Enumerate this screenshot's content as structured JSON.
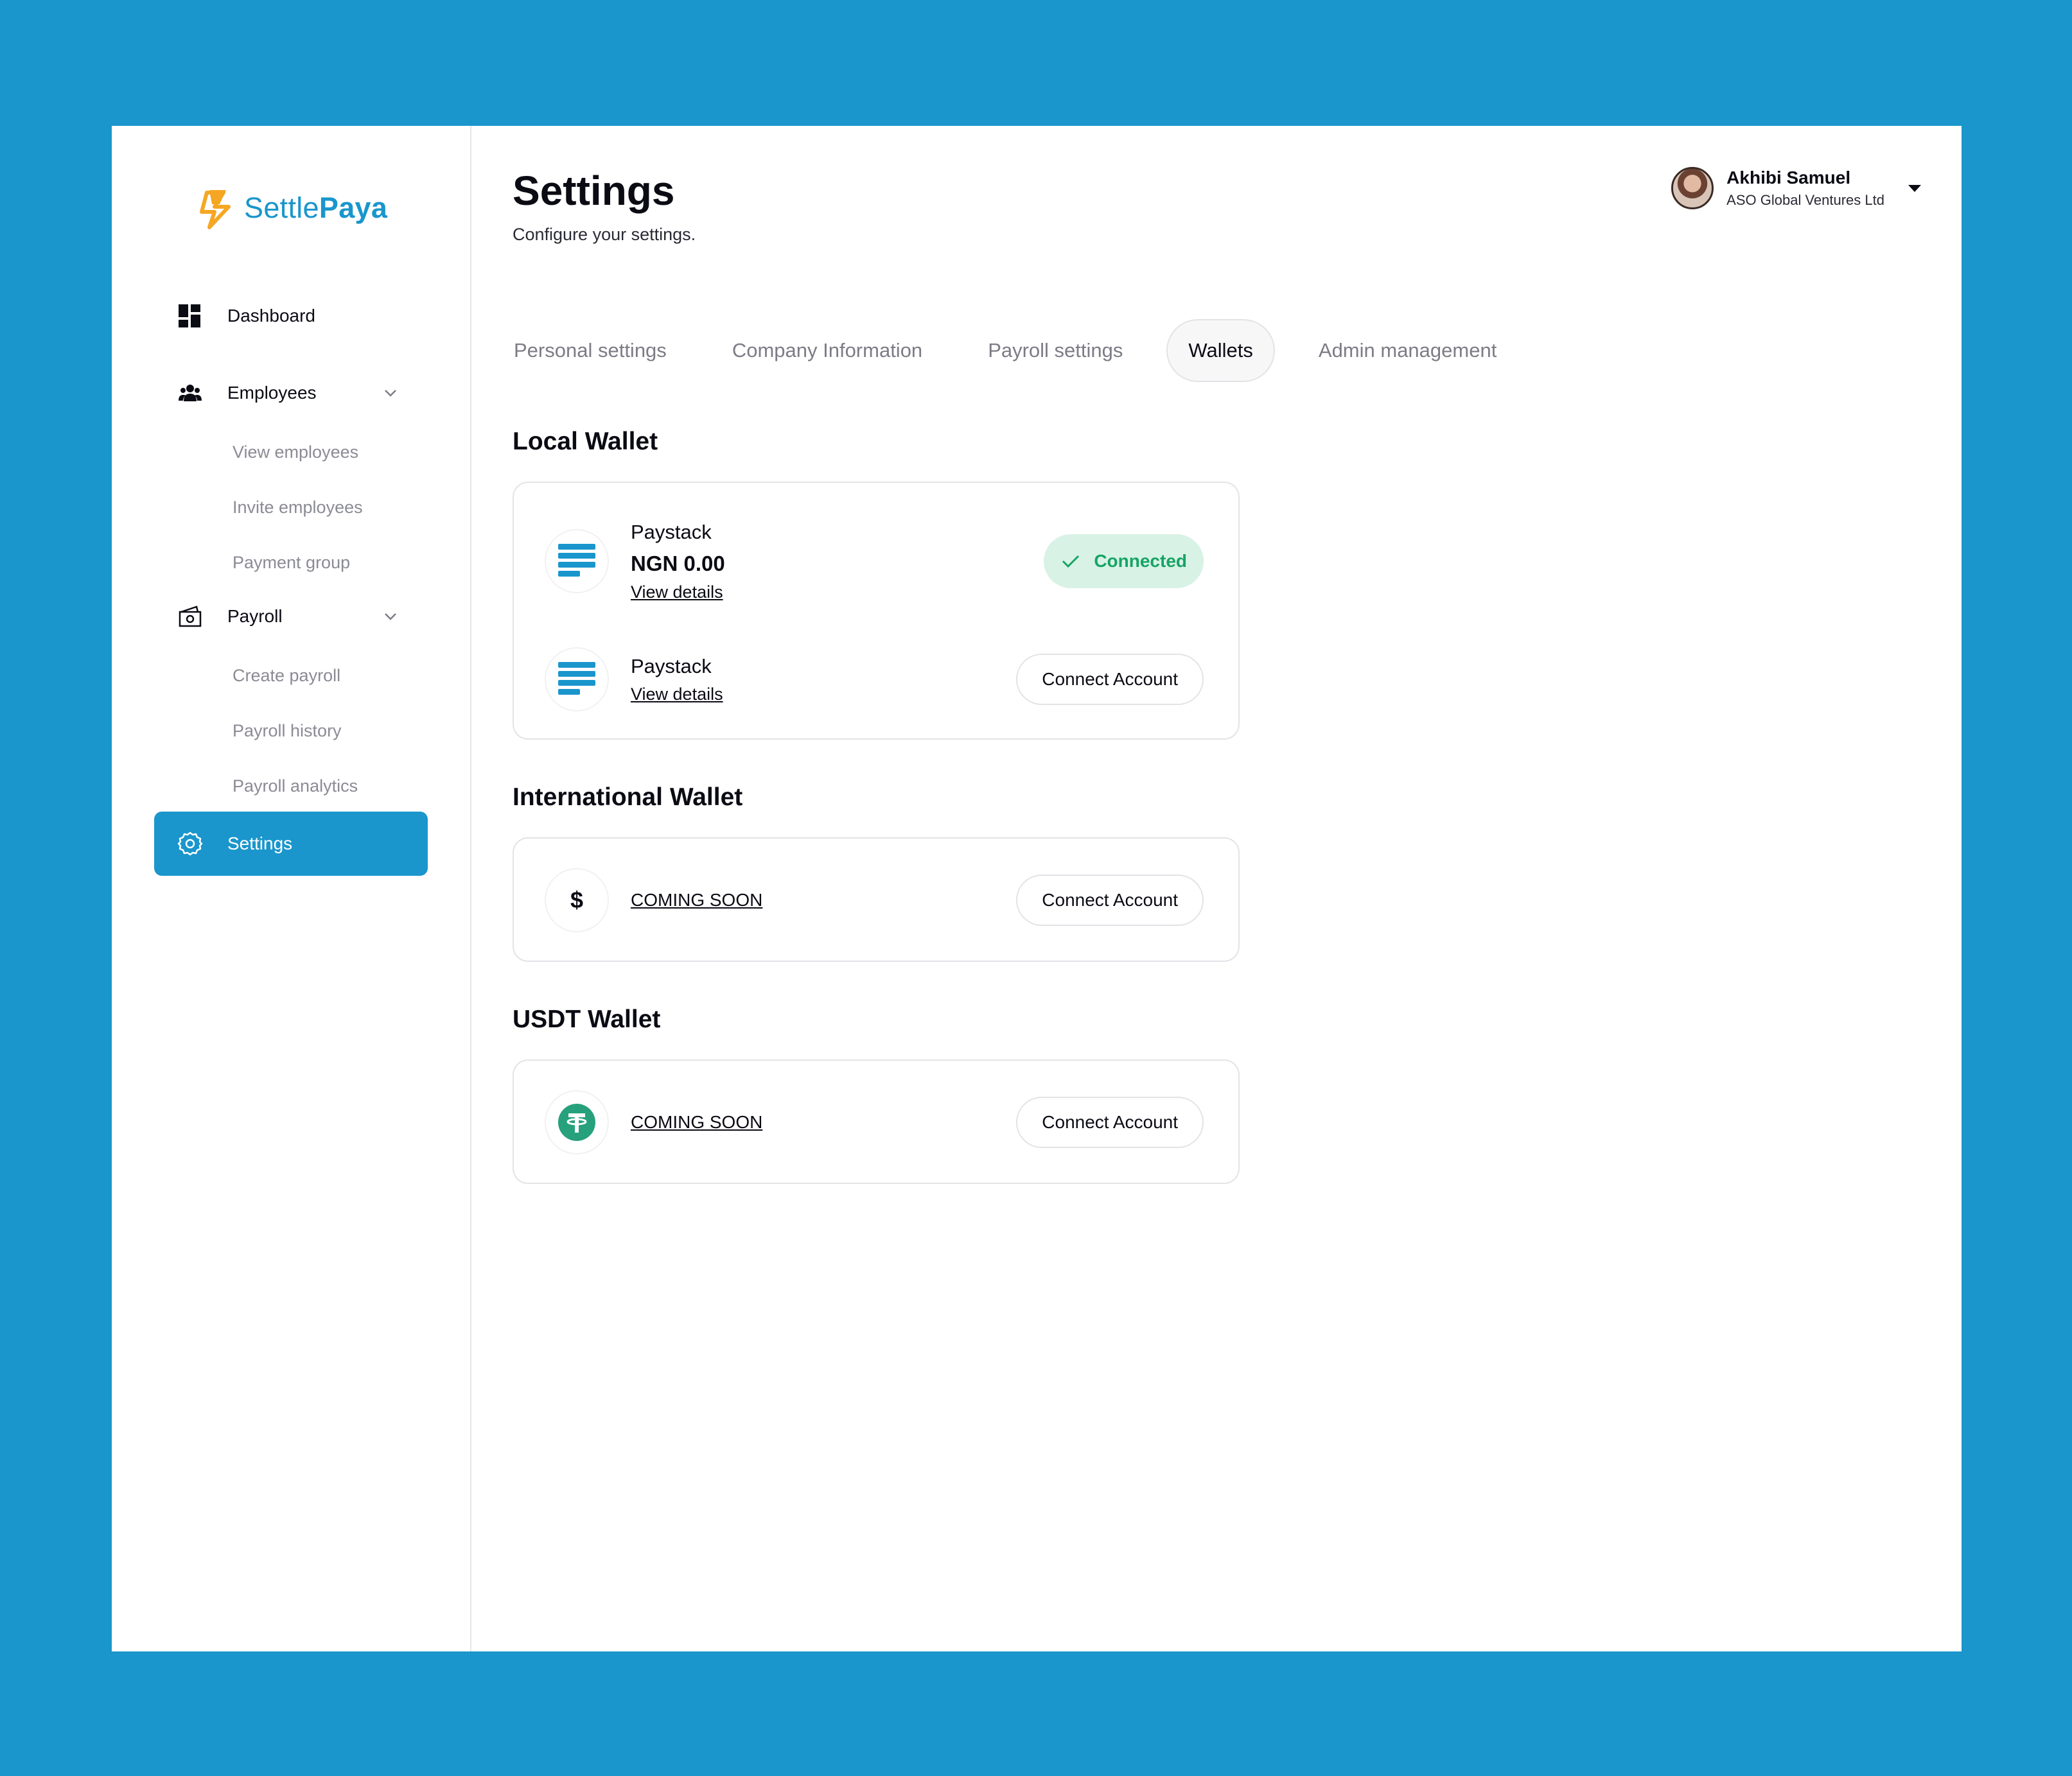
{
  "brand": {
    "name_part1": "Settle",
    "name_part2": "Paya"
  },
  "sidebar": {
    "items": [
      {
        "label": "Dashboard",
        "icon": "grid-icon"
      },
      {
        "label": "Employees",
        "icon": "users-icon",
        "expanded": true,
        "children": [
          "View employees",
          "Invite employees",
          "Payment group"
        ]
      },
      {
        "label": "Payroll",
        "icon": "money-icon",
        "expanded": true,
        "children": [
          "Create payroll",
          "Payroll history",
          "Payroll analytics"
        ]
      },
      {
        "label": "Settings",
        "icon": "gear-icon",
        "active": true
      }
    ]
  },
  "header": {
    "title": "Settings",
    "subtitle": "Configure your settings.",
    "user": {
      "name": "Akhibi Samuel",
      "org": "ASO Global Ventures Ltd"
    }
  },
  "tabs": [
    {
      "label": "Personal settings"
    },
    {
      "label": "Company Information"
    },
    {
      "label": "Payroll settings"
    },
    {
      "label": "Wallets",
      "active": true
    },
    {
      "label": "Admin management"
    }
  ],
  "wallets": {
    "local": {
      "title": "Local Wallet",
      "items": [
        {
          "name": "Paystack",
          "balance": "NGN 0.00",
          "link": "View details",
          "status": "Connected"
        },
        {
          "name": "Paystack",
          "link": "View details",
          "action": "Connect Account"
        }
      ]
    },
    "international": {
      "title": "International Wallet",
      "item": {
        "icon_glyph": "$",
        "text": "COMING SOON",
        "action": "Connect Account"
      }
    },
    "usdt": {
      "title": "USDT Wallet",
      "item": {
        "text": "COMING SOON",
        "action": "Connect Account"
      }
    }
  },
  "colors": {
    "accent": "#1a96cc",
    "logo_mark": "#f5a623",
    "connected_bg": "#d8f2e6",
    "connected_fg": "#16a464",
    "tether": "#26a17b"
  }
}
